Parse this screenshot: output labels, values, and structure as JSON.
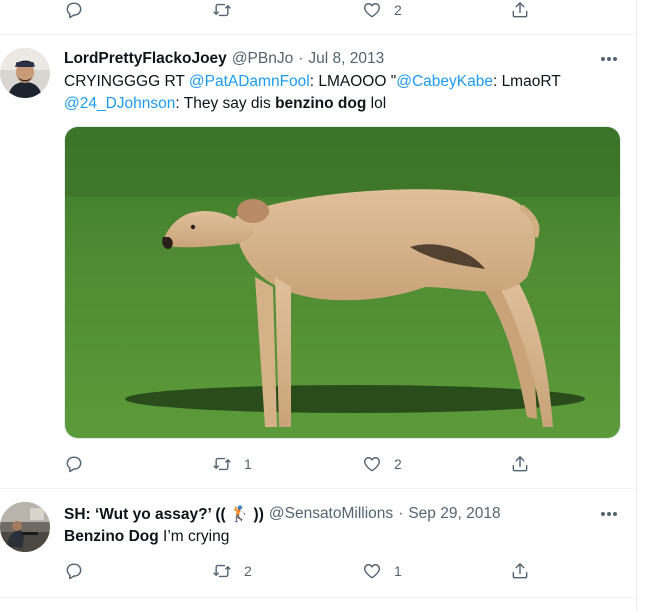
{
  "top_actions": {
    "likes": "2"
  },
  "tweet1": {
    "name": "LordPrettyFlackoJoey",
    "handle": "@PBnJo",
    "sep": "·",
    "date": "Jul 8, 2013",
    "text": {
      "p1": "CRYINGGGG RT ",
      "m1": "@PatADamnFool",
      "p2": ": LMAOOO \"",
      "m2": "@CabeyKabe",
      "p3": ": LmaoRT ",
      "m3": "@24_DJohnson",
      "p4": ": They say dis ",
      "bold": "benzino dog",
      "p5": " lol"
    },
    "retweets": "1",
    "likes": "2"
  },
  "tweet2": {
    "name": "SH: ‘Wut yo assay?’ (( 🏌 ))",
    "handle": "@SensatoMillions",
    "sep": "·",
    "date": "Sep 29, 2018",
    "text": {
      "bold": "Benzino Dog",
      "rest": " I’m crying"
    },
    "retweets": "2",
    "likes": "1"
  },
  "icons": [
    "reply-icon",
    "retweet-icon",
    "like-icon",
    "share-icon",
    "more-icon"
  ],
  "colors": {
    "accent": "#1d9bf0",
    "muted": "#536471",
    "text": "#0f1419",
    "divider": "#eff3f4"
  }
}
